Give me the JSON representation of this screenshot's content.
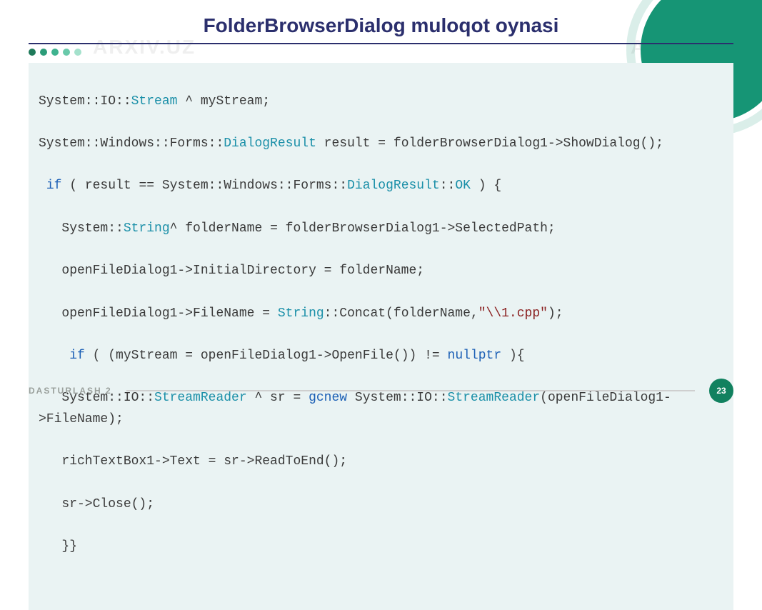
{
  "watermark": "ARXIV.UZ",
  "slide": {
    "title": "FolderBrowserDialog muloqot oynasi",
    "footer": "DASTURLASH 2",
    "page": "23"
  },
  "code": {
    "l1a": "System::IO::",
    "l1b": "Stream",
    "l1c": " ^ myStream;",
    "l2a": "System::Windows::Forms::",
    "l2b": "DialogResult",
    "l2c": " result = folderBrowserDialog1->ShowDialog();",
    "l3a": " ",
    "l3b": "if",
    "l3c": " ( result == System::Windows::Forms::",
    "l3d": "DialogResult",
    "l3e": "::",
    "l3f": "OK",
    "l3g": " ) {",
    "l4a": "   System::",
    "l4b": "String",
    "l4c": "^ folderName = folderBrowserDialog1->SelectedPath;",
    "l5": "   openFileDialog1->InitialDirectory = folderName;",
    "l6a": "   openFileDialog1->FileName = ",
    "l6b": "String",
    "l6c": "::Concat(folderName,",
    "l6d": "\"\\\\1.cpp\"",
    "l6e": ");",
    "l7a": "    ",
    "l7b": "if",
    "l7c": " ( (myStream = openFileDialog1->OpenFile()) != ",
    "l7d": "nullptr",
    "l7e": " ){",
    "l8a": "   System::IO::",
    "l8b": "StreamReader",
    "l8c": " ^ sr = ",
    "l8d": "gcnew",
    "l8e": " System::IO::",
    "l8f": "StreamReader",
    "l8g": "(openFileDialog1->FileName);",
    "l9": "   richTextBox1->Text = sr->ReadToEnd();",
    "l10": "   sr->Close();",
    "l11": "   }}"
  }
}
